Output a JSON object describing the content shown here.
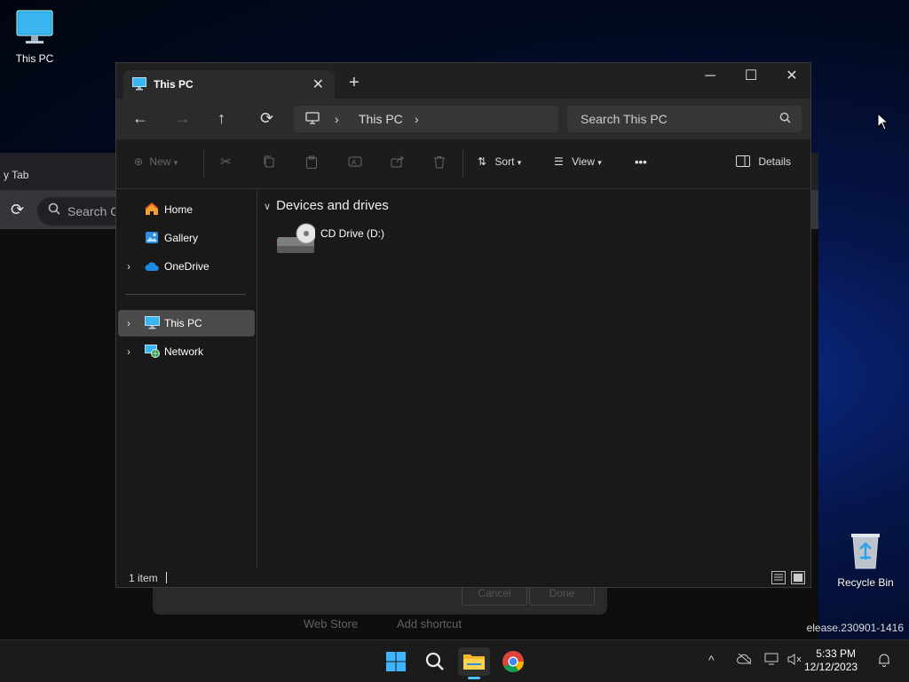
{
  "desktop": {
    "icons": [
      {
        "label": "This PC",
        "icon": "monitor-icon"
      },
      {
        "label": "Recycle Bin",
        "icon": "recycle-bin-icon"
      }
    ],
    "build_watermark": "elease.230901-1416"
  },
  "background_browser": {
    "tab_label": "y Tab",
    "search_placeholder": "Search G",
    "dialog_buttons": {
      "cancel": "Cancel",
      "done": "Done"
    },
    "links": [
      "Web Store",
      "Add shortcut"
    ]
  },
  "explorer": {
    "tab": {
      "title": "This PC",
      "icon": "monitor-icon"
    },
    "window_controls": {
      "minimize": "─",
      "maximize": "☐",
      "close": "✕"
    },
    "nav": {
      "back": "←",
      "forward": "→",
      "up": "↑",
      "refresh": "⟳"
    },
    "address": {
      "segments": [
        "This PC"
      ]
    },
    "search": {
      "placeholder": "Search This PC"
    },
    "toolbar": {
      "new_label": "New",
      "sort_label": "Sort",
      "view_label": "View",
      "more_label": "•••",
      "details_label": "Details"
    },
    "sidebar": {
      "items": [
        {
          "label": "Home",
          "icon": "home-icon",
          "expandable": false
        },
        {
          "label": "Gallery",
          "icon": "gallery-icon",
          "expandable": false
        },
        {
          "label": "OneDrive",
          "icon": "cloud-icon",
          "expandable": true
        },
        {
          "label": "This PC",
          "icon": "monitor-icon",
          "expandable": true,
          "selected": true
        },
        {
          "label": "Network",
          "icon": "network-icon",
          "expandable": true
        }
      ]
    },
    "content": {
      "group_title": "Devices and drives",
      "items": [
        {
          "label": "CD Drive (D:)",
          "icon": "cd-drive-icon"
        }
      ]
    },
    "status": {
      "item_count": "1 item"
    }
  },
  "taskbar": {
    "apps": [
      "start-icon",
      "search-icon",
      "file-explorer-icon",
      "chrome-icon"
    ],
    "active_app": "file-explorer-icon",
    "tray": [
      "chevron-up-icon",
      "onedrive-icon",
      "network-icon",
      "volume-icon",
      "notification-icon"
    ],
    "clock": {
      "time": "5:33 PM",
      "date": "12/12/2023"
    }
  },
  "colors": {
    "accent": "#4cc2ff",
    "explorer_bg": "#191919",
    "selected": "#4a4a4a"
  }
}
